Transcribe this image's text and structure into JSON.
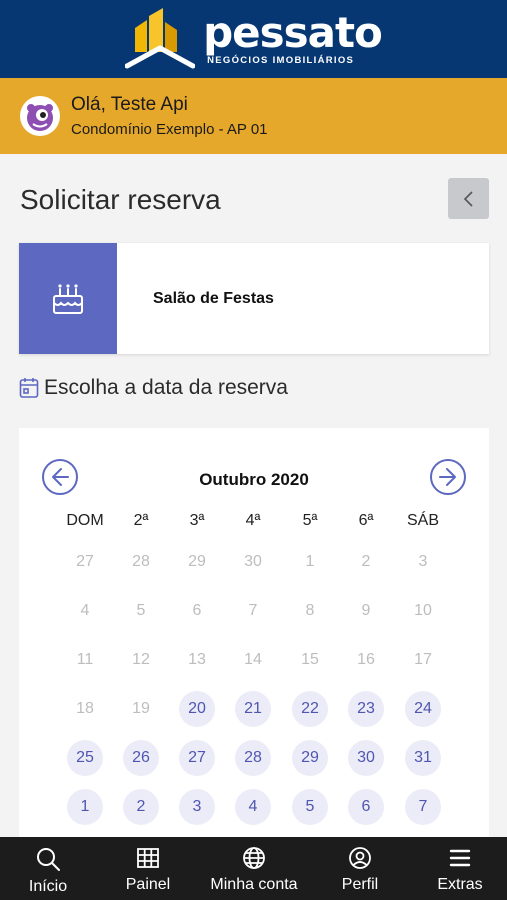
{
  "header": {
    "brand": "pessato",
    "tagline": "NEGÓCIOS IMOBILIÁRIOS",
    "brand_color": "#063773",
    "logo_color": "#f2b705"
  },
  "user": {
    "greeting": "Olá, Teste Api",
    "unit": "Condomínio Exemplo - AP 01",
    "bar_color": "#e6a82b"
  },
  "page": {
    "title": "Solicitar reserva",
    "back_icon": "chevron-left-icon"
  },
  "room": {
    "name": "Salão de Festas",
    "icon": "cake-icon",
    "icon_bg": "#5d68c1"
  },
  "choose_date": {
    "label": "Escolha a data da reserva",
    "icon": "calendar-icon"
  },
  "calendar": {
    "month_label": "Outubro 2020",
    "prev_icon": "arrow-left-circle-icon",
    "next_icon": "arrow-right-circle-icon",
    "weekdays": [
      "DOM",
      "2ª",
      "3ª",
      "4ª",
      "5ª",
      "6ª",
      "SÁB"
    ],
    "weeks": [
      [
        {
          "d": "27",
          "s": "disabled"
        },
        {
          "d": "28",
          "s": "disabled"
        },
        {
          "d": "29",
          "s": "disabled"
        },
        {
          "d": "30",
          "s": "disabled"
        },
        {
          "d": "1",
          "s": "disabled"
        },
        {
          "d": "2",
          "s": "disabled"
        },
        {
          "d": "3",
          "s": "disabled"
        }
      ],
      [
        {
          "d": "4",
          "s": "disabled"
        },
        {
          "d": "5",
          "s": "disabled"
        },
        {
          "d": "6",
          "s": "disabled"
        },
        {
          "d": "7",
          "s": "disabled"
        },
        {
          "d": "8",
          "s": "disabled"
        },
        {
          "d": "9",
          "s": "disabled"
        },
        {
          "d": "10",
          "s": "disabled"
        }
      ],
      [
        {
          "d": "11",
          "s": "disabled"
        },
        {
          "d": "12",
          "s": "disabled"
        },
        {
          "d": "13",
          "s": "disabled"
        },
        {
          "d": "14",
          "s": "disabled"
        },
        {
          "d": "15",
          "s": "disabled"
        },
        {
          "d": "16",
          "s": "disabled"
        },
        {
          "d": "17",
          "s": "disabled"
        }
      ],
      [
        {
          "d": "18",
          "s": "disabled"
        },
        {
          "d": "19",
          "s": "disabled"
        },
        {
          "d": "20",
          "s": "available"
        },
        {
          "d": "21",
          "s": "available"
        },
        {
          "d": "22",
          "s": "available"
        },
        {
          "d": "23",
          "s": "available"
        },
        {
          "d": "24",
          "s": "available"
        }
      ],
      [
        {
          "d": "25",
          "s": "available"
        },
        {
          "d": "26",
          "s": "available"
        },
        {
          "d": "27",
          "s": "available"
        },
        {
          "d": "28",
          "s": "available"
        },
        {
          "d": "29",
          "s": "available"
        },
        {
          "d": "30",
          "s": "available"
        },
        {
          "d": "31",
          "s": "available"
        }
      ],
      [
        {
          "d": "1",
          "s": "available"
        },
        {
          "d": "2",
          "s": "available"
        },
        {
          "d": "3",
          "s": "available"
        },
        {
          "d": "4",
          "s": "available"
        },
        {
          "d": "5",
          "s": "available"
        },
        {
          "d": "6",
          "s": "available"
        },
        {
          "d": "7",
          "s": "available"
        }
      ]
    ],
    "accent": "#5d68c1"
  },
  "bottom_nav": [
    {
      "label": "Início",
      "icon": "search-icon"
    },
    {
      "label": "Painel",
      "icon": "grid-icon"
    },
    {
      "label": "Minha conta",
      "icon": "globe-icon"
    },
    {
      "label": "Perfil",
      "icon": "user-circle-icon"
    },
    {
      "label": "Extras",
      "icon": "menu-icon"
    }
  ]
}
